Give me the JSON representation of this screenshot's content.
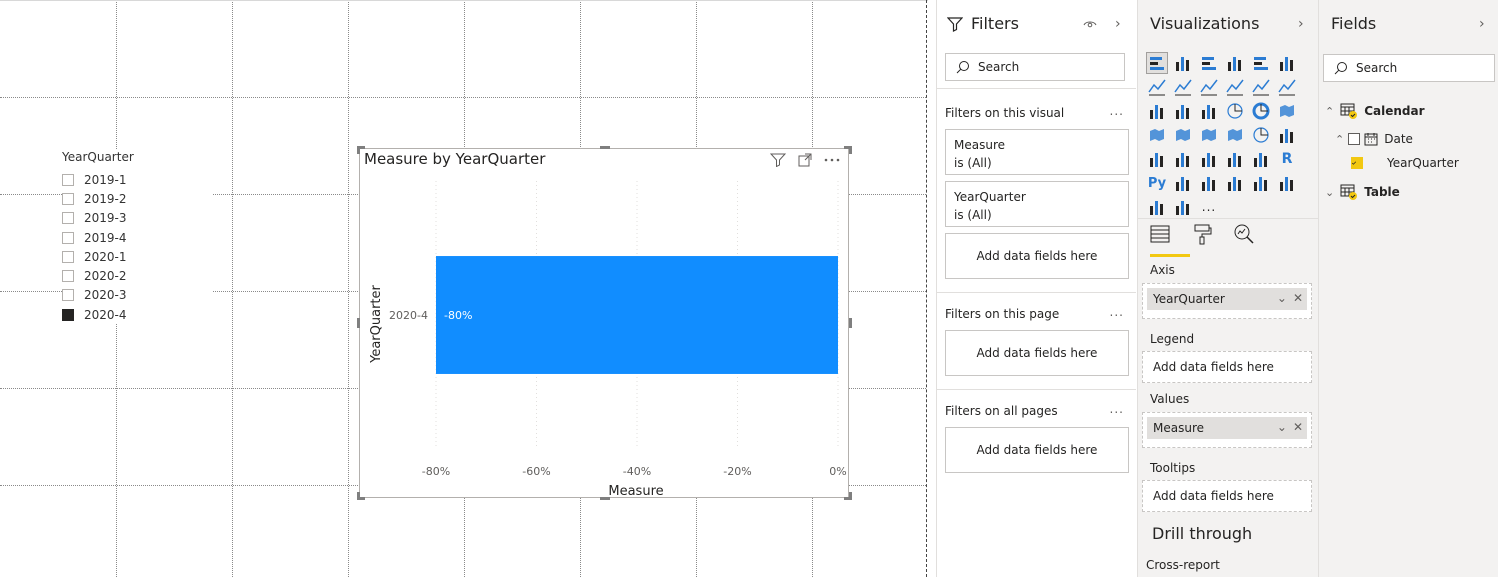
{
  "slicer": {
    "title": "YearQuarter",
    "items": [
      {
        "label": "2019-1",
        "checked": false
      },
      {
        "label": "2019-2",
        "checked": false
      },
      {
        "label": "2019-3",
        "checked": false
      },
      {
        "label": "2019-4",
        "checked": false
      },
      {
        "label": "2020-1",
        "checked": false
      },
      {
        "label": "2020-2",
        "checked": false
      },
      {
        "label": "2020-3",
        "checked": false
      },
      {
        "label": "2020-4",
        "checked": true
      }
    ]
  },
  "visual": {
    "title": "Measure by YearQuarter",
    "icons": [
      "filter-icon",
      "focus-mode-icon",
      "more-options-icon"
    ]
  },
  "chart_data": {
    "type": "bar",
    "orientation": "horizontal",
    "title": "Measure by YearQuarter",
    "xlabel": "Measure",
    "ylabel": "YearQuarter",
    "categories": [
      "2020-4"
    ],
    "values": [
      -0.8
    ],
    "data_labels": [
      "-80%"
    ],
    "xlim": [
      -0.8,
      0
    ],
    "xticks": [
      "-80%",
      "-60%",
      "-40%",
      "-20%",
      "0%"
    ],
    "bar_color": "#118DFF",
    "grid": true
  },
  "filters": {
    "title": "Filters",
    "search_placeholder": "Search",
    "visual_section": "Filters on this visual",
    "cards": [
      {
        "field": "Measure",
        "state": "is (All)"
      },
      {
        "field": "YearQuarter",
        "state": "is (All)"
      }
    ],
    "add_fields": "Add data fields here",
    "page_section": "Filters on this page",
    "all_section": "Filters on all pages",
    "more": "..."
  },
  "visualizations": {
    "title": "Visualizations",
    "more": "...",
    "wells": {
      "axis": "Axis",
      "axis_field": "YearQuarter",
      "legend": "Legend",
      "values": "Values",
      "values_field": "Measure",
      "tooltips": "Tooltips",
      "add": "Add data fields here"
    },
    "drill_through": "Drill through",
    "cross_report": "Cross-report",
    "accent": "#F2C811"
  },
  "fields": {
    "title": "Fields",
    "search_placeholder": "Search",
    "tables": [
      {
        "name": "Calendar",
        "children": [
          {
            "name": "Date",
            "children": [
              {
                "name": "YearQuarter",
                "checked": true
              }
            ]
          }
        ]
      },
      {
        "name": "Table"
      }
    ]
  }
}
